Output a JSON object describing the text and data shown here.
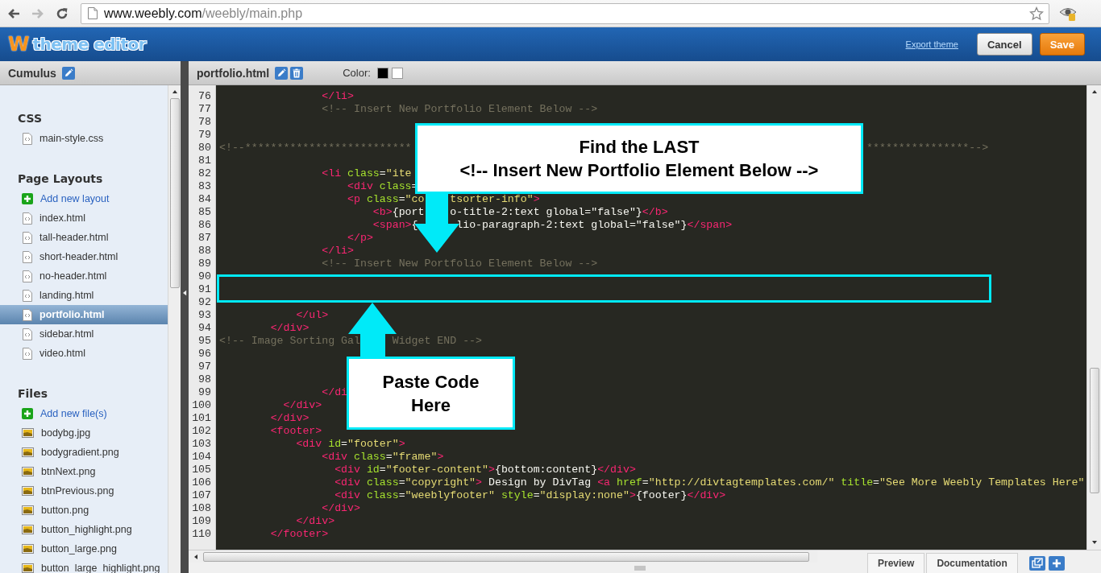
{
  "browser": {
    "url_host": "www.weebly.com",
    "url_path": "/weebly/main.php",
    "back_enabled": true,
    "forward_enabled": false
  },
  "app_header": {
    "logo_mark": "W",
    "logo_text": "theme editor",
    "export_link": "Export theme",
    "buttons": [
      {
        "label": "Cancel",
        "kind": "secondary"
      },
      {
        "label": "Save",
        "kind": "primary"
      }
    ]
  },
  "sidebar": {
    "title": "Cumulus",
    "sections": [
      {
        "heading": "CSS",
        "items": [
          {
            "label": "main-style.css",
            "kind": "page",
            "selected": false
          }
        ]
      },
      {
        "heading": "Page Layouts",
        "items": [
          {
            "label": "Add new layout",
            "kind": "add",
            "selected": false
          },
          {
            "label": "index.html",
            "kind": "page",
            "selected": false
          },
          {
            "label": "tall-header.html",
            "kind": "page",
            "selected": false
          },
          {
            "label": "short-header.html",
            "kind": "page",
            "selected": false
          },
          {
            "label": "no-header.html",
            "kind": "page",
            "selected": false
          },
          {
            "label": "landing.html",
            "kind": "page",
            "selected": false
          },
          {
            "label": "portfolio.html",
            "kind": "page",
            "selected": true
          },
          {
            "label": "sidebar.html",
            "kind": "page",
            "selected": false
          },
          {
            "label": "video.html",
            "kind": "page",
            "selected": false
          }
        ]
      },
      {
        "heading": "Files",
        "items": [
          {
            "label": "Add new file(s)",
            "kind": "add",
            "selected": false
          },
          {
            "label": "bodybg.jpg",
            "kind": "image",
            "selected": false
          },
          {
            "label": "bodygradient.png",
            "kind": "image",
            "selected": false
          },
          {
            "label": "btnNext.png",
            "kind": "image",
            "selected": false
          },
          {
            "label": "btnPrevious.png",
            "kind": "image",
            "selected": false
          },
          {
            "label": "button.png",
            "kind": "image",
            "selected": false
          },
          {
            "label": "button_highlight.png",
            "kind": "image",
            "selected": false
          },
          {
            "label": "button_large.png",
            "kind": "image",
            "selected": false
          },
          {
            "label": "button_large_highlight.png",
            "kind": "image",
            "selected": false
          }
        ]
      }
    ]
  },
  "editor": {
    "file_name": "portfolio.html",
    "color_label": "Color:",
    "color_swatches": [
      {
        "color": "#000000"
      },
      {
        "color": "#ffffff"
      }
    ],
    "lines": [
      {
        "number": "76",
        "parts": [
          [
            {
              "kind": "tag",
              "text": "                </li>"
            }
          ]
        ]
      },
      {
        "number": "77",
        "parts": [
          [
            {
              "kind": "comment",
              "text": "                <!-- Insert New Portfolio Element Below -->"
            }
          ]
        ]
      },
      {
        "number": "78"
      },
      {
        "number": "79"
      },
      {
        "number": "80",
        "parts": [
          [
            {
              "kind": "comment",
              "text": "<!--**************************"
            }
          ],
          [
            {
              "kind": "comment",
              "text": "                                                                       ****************-->"
            }
          ]
        ]
      },
      {
        "number": "81"
      },
      {
        "number": "82",
        "parts": [
          [
            {
              "kind": "tag",
              "text": "                <li "
            },
            {
              "kind": "attr",
              "text": "class"
            },
            {
              "kind": "text",
              "text": "="
            },
            {
              "kind": "string",
              "text": "\"ite"
            }
          ]
        ]
      },
      {
        "number": "83",
        "parts": [
          [
            {
              "kind": "tag",
              "text": "                    <div "
            },
            {
              "kind": "attr",
              "text": "class"
            },
            {
              "kind": "text",
              "text": "="
            }
          ]
        ]
      },
      {
        "number": "84",
        "parts": [
          [
            {
              "kind": "tag",
              "text": "                    <p "
            },
            {
              "kind": "attr",
              "text": "class"
            },
            {
              "kind": "text",
              "text": "="
            },
            {
              "kind": "string",
              "text": "\"co"
            }
          ],
          [
            {
              "kind": "string",
              "text": "    tsorter-info\""
            },
            {
              "kind": "tag",
              "text": ">"
            }
          ]
        ]
      },
      {
        "number": "85",
        "parts": [
          [
            {
              "kind": "tag",
              "text": "                        <b>"
            },
            {
              "kind": "text",
              "text": "{port"
            }
          ],
          [
            {
              "kind": "text",
              "text": "    o-title-2:text global=\"false\"}"
            },
            {
              "kind": "tag",
              "text": "</b>"
            }
          ]
        ]
      },
      {
        "number": "86",
        "parts": [
          [
            {
              "kind": "tag",
              "text": "                        <span>"
            },
            {
              "kind": "text",
              "text": "{"
            }
          ],
          [
            {
              "kind": "text",
              "text": "      lio-paragraph-2:text global=\"false\"}"
            },
            {
              "kind": "tag",
              "text": "</span>"
            }
          ]
        ]
      },
      {
        "number": "87",
        "parts": [
          [
            {
              "kind": "tag",
              "text": "                    </p>"
            }
          ]
        ]
      },
      {
        "number": "88",
        "parts": [
          [
            {
              "kind": "tag",
              "text": "                </li>"
            }
          ]
        ]
      },
      {
        "number": "89",
        "parts": [
          [
            {
              "kind": "comment",
              "text": "                <!-- Insert New Portfolio Element Below -->"
            }
          ]
        ]
      },
      {
        "number": "90"
      },
      {
        "number": "91"
      },
      {
        "number": "92"
      },
      {
        "number": "93",
        "parts": [
          [
            {
              "kind": "tag",
              "text": "            </ul>"
            }
          ]
        ]
      },
      {
        "number": "94",
        "parts": [
          [
            {
              "kind": "tag",
              "text": "        </div>"
            }
          ]
        ]
      },
      {
        "number": "95",
        "parts": [
          [
            {
              "kind": "comment",
              "text": "<!-- Image Sorting Gal"
            }
          ],
          [
            {
              "kind": "comment",
              "text": "     Widget END -->"
            }
          ]
        ]
      },
      {
        "number": "96"
      },
      {
        "number": "97"
      },
      {
        "number": "98"
      },
      {
        "number": "99",
        "parts": [
          [
            {
              "kind": "tag",
              "text": "                </di"
            }
          ]
        ]
      },
      {
        "number": "100",
        "parts": [
          [
            {
              "kind": "tag",
              "text": "          </div>"
            }
          ]
        ]
      },
      {
        "number": "101",
        "parts": [
          [
            {
              "kind": "tag",
              "text": "        </div>"
            }
          ]
        ]
      },
      {
        "number": "102",
        "parts": [
          [
            {
              "kind": "tag",
              "text": "        <footer>"
            }
          ]
        ]
      },
      {
        "number": "103",
        "parts": [
          [
            {
              "kind": "tag",
              "text": "            <div "
            },
            {
              "kind": "attr",
              "text": "id"
            },
            {
              "kind": "text",
              "text": "="
            },
            {
              "kind": "string",
              "text": "\"footer\""
            },
            {
              "kind": "tag",
              "text": ">"
            }
          ]
        ]
      },
      {
        "number": "104",
        "parts": [
          [
            {
              "kind": "tag",
              "text": "                <div "
            },
            {
              "kind": "attr",
              "text": "class"
            },
            {
              "kind": "text",
              "text": "="
            },
            {
              "kind": "string",
              "text": "\"frame\""
            },
            {
              "kind": "tag",
              "text": ">"
            }
          ]
        ]
      },
      {
        "number": "105",
        "parts": [
          [
            {
              "kind": "tag",
              "text": "                  <div "
            },
            {
              "kind": "attr",
              "text": "id"
            },
            {
              "kind": "text",
              "text": "="
            },
            {
              "kind": "string",
              "text": "\"footer-content\""
            },
            {
              "kind": "tag",
              "text": ">"
            },
            {
              "kind": "text",
              "text": "{bottom:content}"
            },
            {
              "kind": "tag",
              "text": "</div>"
            }
          ]
        ]
      },
      {
        "number": "106",
        "parts": [
          [
            {
              "kind": "tag",
              "text": "                  <div "
            },
            {
              "kind": "attr",
              "text": "class"
            },
            {
              "kind": "text",
              "text": "="
            },
            {
              "kind": "string",
              "text": "\"copyright\""
            },
            {
              "kind": "tag",
              "text": ">"
            },
            {
              "kind": "text",
              "text": " Design by DivTag "
            },
            {
              "kind": "tag",
              "text": "<a "
            },
            {
              "kind": "attr",
              "text": "href"
            },
            {
              "kind": "text",
              "text": "="
            },
            {
              "kind": "string",
              "text": "\"http://divtagtemplates.com/\" "
            },
            {
              "kind": "attr",
              "text": "title"
            },
            {
              "kind": "text",
              "text": "="
            },
            {
              "kind": "string",
              "text": "\"See More Weebly Templates Here\""
            }
          ]
        ]
      },
      {
        "number": "107",
        "parts": [
          [
            {
              "kind": "tag",
              "text": "                  <div "
            },
            {
              "kind": "attr",
              "text": "class"
            },
            {
              "kind": "text",
              "text": "="
            },
            {
              "kind": "string",
              "text": "\"weeblyfooter\" "
            },
            {
              "kind": "attr",
              "text": "style"
            },
            {
              "kind": "text",
              "text": "="
            },
            {
              "kind": "string",
              "text": "\"display:none\""
            },
            {
              "kind": "tag",
              "text": ">"
            },
            {
              "kind": "text",
              "text": "{footer}"
            },
            {
              "kind": "tag",
              "text": "</div>"
            }
          ]
        ]
      },
      {
        "number": "108",
        "parts": [
          [
            {
              "kind": "tag",
              "text": "                </div>"
            }
          ]
        ]
      },
      {
        "number": "109",
        "parts": [
          [
            {
              "kind": "tag",
              "text": "            </div>"
            }
          ]
        ]
      },
      {
        "number": "110",
        "parts": [
          [
            {
              "kind": "tag",
              "text": "        </footer>"
            }
          ]
        ]
      }
    ],
    "annotations": [
      {
        "kind": "callout",
        "arrow_up": false,
        "lines": [
          "Find the LAST",
          "<!-- Insert New Portfolio Element Below -->"
        ]
      },
      {
        "kind": "frame"
      },
      {
        "kind": "callout",
        "arrow_up": true,
        "lines": [
          "Paste Code",
          "Here"
        ]
      }
    ]
  },
  "bottom_tabs": [
    {
      "label": "Preview"
    },
    {
      "label": "Documentation"
    }
  ]
}
